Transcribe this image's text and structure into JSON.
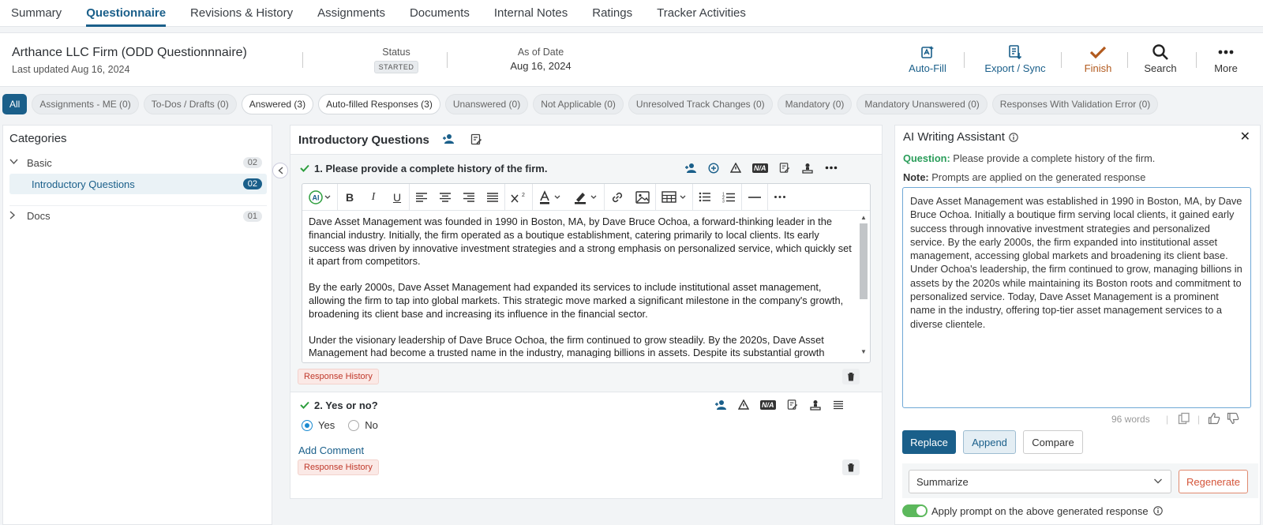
{
  "tabs": [
    "Summary",
    "Questionnaire",
    "Revisions & History",
    "Assignments",
    "Documents",
    "Internal Notes",
    "Ratings",
    "Tracker Activities"
  ],
  "active_tab": "Questionnaire",
  "header": {
    "title": "Arthance LLC Firm (ODD Questionnnaire)",
    "last_updated": "Last updated Aug 16, 2024",
    "status_label": "Status",
    "status_value": "STARTED",
    "asof_label": "As of Date",
    "asof_value": "Aug 16, 2024",
    "actions": {
      "autofill": "Auto-Fill",
      "export": "Export / Sync",
      "finish": "Finish",
      "search": "Search",
      "more": "More"
    }
  },
  "filters": [
    "All",
    "Assignments - ME (0)",
    "To-Dos / Drafts (0)",
    "Answered (3)",
    "Auto-filled Responses (3)",
    "Unanswered (0)",
    "Not Applicable (0)",
    "Unresolved Track Changes (0)",
    "Mandatory (0)",
    "Mandatory Unanswered (0)",
    "Responses With Validation Error (0)"
  ],
  "categories": {
    "title": "Categories",
    "basic": {
      "label": "Basic",
      "count": "02"
    },
    "intro": {
      "label": "Introductory Questions",
      "count": "02"
    },
    "docs": {
      "label": "Docs",
      "count": "01"
    }
  },
  "section": {
    "title": "Introductory Questions",
    "q1": {
      "label": "1.  Please provide a complete history of the firm.",
      "paragraphs": [
        "Dave Asset Management was founded in 1990 in Boston, MA, by Dave Bruce Ochoa, a forward-thinking leader in the financial industry. Initially, the firm operated as a boutique establishment, catering primarily to local clients. Its early success was driven by innovative investment strategies and a strong emphasis on personalized service, which quickly set it apart from competitors.",
        "By the early 2000s, Dave Asset Management had expanded its services to include institutional asset management, allowing the firm to tap into global markets. This strategic move marked a significant milestone in the company's growth, broadening its client base and increasing its influence in the financial sector.",
        "Under the visionary leadership of Dave Bruce Ochoa, the firm continued to grow steadily. By the 2020s, Dave Asset Management had become a trusted name in the industry, managing billions in assets. Despite its substantial growth"
      ],
      "response_history": "Response History",
      "na": "N/A"
    },
    "q2": {
      "label": "2.  Yes or no?",
      "yes": "Yes",
      "no": "No",
      "add_comment": "Add Comment",
      "response_history": "Response History",
      "na": "N/A"
    }
  },
  "ai": {
    "title": "AI Writing Assistant",
    "question_label": "Question:",
    "question_text": "Please provide a complete history of the firm.",
    "note_label": "Note:",
    "note_text": "Prompts are applied on the generated response",
    "response": "Dave Asset Management was established in 1990 in Boston, MA, by Dave Bruce Ochoa. Initially a boutique firm serving local clients, it gained early success through innovative investment strategies and personalized service. By the early 2000s, the firm expanded into institutional asset management, accessing global markets and broadening its client base. Under Ochoa's leadership, the firm continued to grow, managing billions in assets by the 2020s while maintaining its Boston roots and commitment to personalized service. Today, Dave Asset Management is a prominent name in the industry, offering top-tier asset management services to a diverse clientele.",
    "word_count": "96 words",
    "replace": "Replace",
    "append": "Append",
    "compare": "Compare",
    "prompt_value": "Summarize",
    "regenerate": "Regenerate",
    "apply_label": "Apply prompt on the above generated response"
  },
  "colors": {
    "primary": "#1a5f8a",
    "finish": "#b25a1e",
    "success": "#2e9e3e",
    "danger": "#d4553a"
  }
}
